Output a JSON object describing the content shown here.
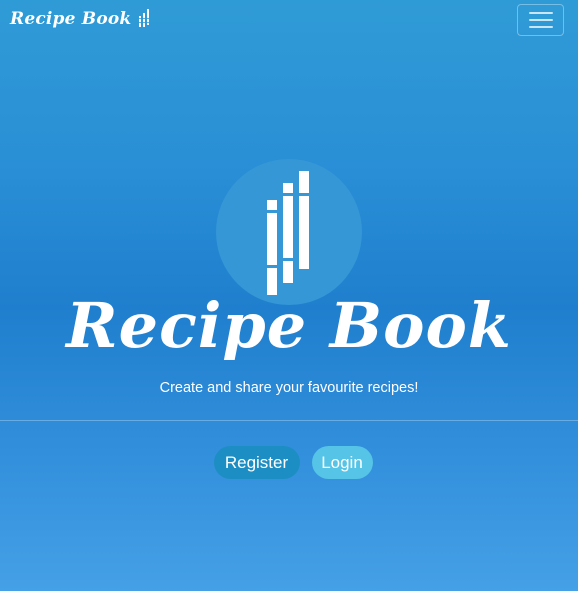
{
  "navbar": {
    "brand": "Recipe Book",
    "brand_icon": "recipe-bars-icon",
    "toggler_icon": "hamburger-menu-icon"
  },
  "hero": {
    "logo_icon": "recipe-bars-icon",
    "title": "Recipe Book",
    "tagline": "Create and share your favourite recipes!"
  },
  "actions": {
    "register_label": "Register",
    "login_label": "Login"
  },
  "colors": {
    "background_top": "#2f9bd6",
    "background_mid": "#1f7fce",
    "background_bottom": "#45a0e6",
    "logo_circle": "#3597d6",
    "register_button": "#1d8ec3",
    "login_button": "#55c4e6",
    "text": "#ffffff"
  }
}
